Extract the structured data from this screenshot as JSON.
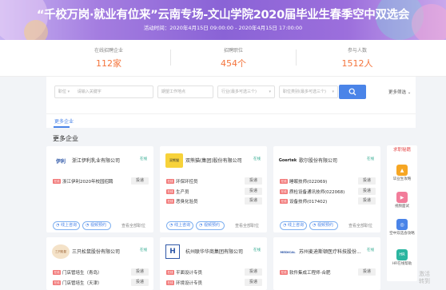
{
  "banner": {
    "title": "“千校万岗·就业有位来”云南专场-文山学院2020届毕业生春季空中双选会",
    "time": "活动时间：2020年4月15日 09:00:00 - 2020年4月15日 17:00:00"
  },
  "stats": [
    {
      "label": "在线招聘企业",
      "value": "112家"
    },
    {
      "label": "招聘职位",
      "value": "454个"
    },
    {
      "label": "参与人数",
      "value": "1512人"
    }
  ],
  "search": {
    "category": "职位",
    "keyword_placeholder": "请输入关键字",
    "work_location": "期望工作地点",
    "industry": "行业(最多可选三个)",
    "job_category": "职位类别(最多可选三个)",
    "advanced": "更多筛选"
  },
  "tabs": {
    "active": "更多企业"
  },
  "section_title": "更多企业",
  "cards": [
    {
      "logo_text": "伊利",
      "name": "浙江伊利乳业有限公司",
      "badge": "在线",
      "jobs": [
        {
          "tag": "在线",
          "name": "浙江伊利2020年校园招聘",
          "button": "投递"
        }
      ],
      "online_btn": "线上咨询",
      "video_btn": "视频预约",
      "more": "查看全部职位"
    },
    {
      "logo_text": "双熊猫",
      "name": "双熊猫(集团)股份有限公司",
      "badge": "在线",
      "jobs": [
        {
          "tag": "在线",
          "name": "环保环控员",
          "button": "投递"
        },
        {
          "tag": "在线",
          "name": "生产员",
          "button": "投递"
        },
        {
          "tag": "在线",
          "name": "恶臭化验员",
          "button": "投递"
        }
      ],
      "online_btn": "线上咨询",
      "video_btn": "视频预约",
      "more": "查看全部职位"
    },
    {
      "logo_text": "Goertek",
      "name": "歌尔股份有限公司",
      "badge": "在线",
      "jobs": [
        {
          "tag": "在线",
          "name": "睡眠技师(022069)",
          "button": "投递"
        },
        {
          "tag": "在线",
          "name": "质检设备通讯技师(022068)",
          "button": "投递"
        },
        {
          "tag": "在线",
          "name": "设备技师(017402)",
          "button": "投递"
        }
      ],
      "online_btn": "线上咨询",
      "video_btn": "视频预约",
      "more": "查看全部职位"
    },
    {
      "logo_text": "三只松鼠",
      "name": "三只松鼠股份有限公司",
      "badge": "在线",
      "jobs": [
        {
          "tag": "在线",
          "name": "门店管培生（青岛）",
          "button": "投递"
        },
        {
          "tag": "在线",
          "name": "门店管培生（天津）",
          "button": "投递"
        }
      ]
    },
    {
      "logo_text": "H",
      "name": "杭州联华华商集团有限公司",
      "badge": "在线",
      "jobs": [
        {
          "tag": "在线",
          "name": "平面设计专员",
          "button": "投递"
        },
        {
          "tag": "在线",
          "name": "环境设计专员",
          "button": "投递"
        }
      ]
    },
    {
      "logo_text": "MEDICAL",
      "name": "苏州麦迪斯顿医疗科技股份...",
      "badge": "在线",
      "jobs": [
        {
          "tag": "在线",
          "name": "软件集成工程师-合肥",
          "button": "投递"
        }
      ]
    }
  ],
  "sidebar": {
    "top": "求职秘籍",
    "items": [
      {
        "label": "毕业生攻略",
        "icon": "graduation-cap-icon"
      },
      {
        "label": "视频面试",
        "icon": "video-icon"
      },
      {
        "label": "空中双选会攻略",
        "icon": "broadcast-icon"
      },
      {
        "label": "HR在线帮助",
        "icon": "hr-help-icon"
      }
    ]
  },
  "watermark": "激活\n转到"
}
